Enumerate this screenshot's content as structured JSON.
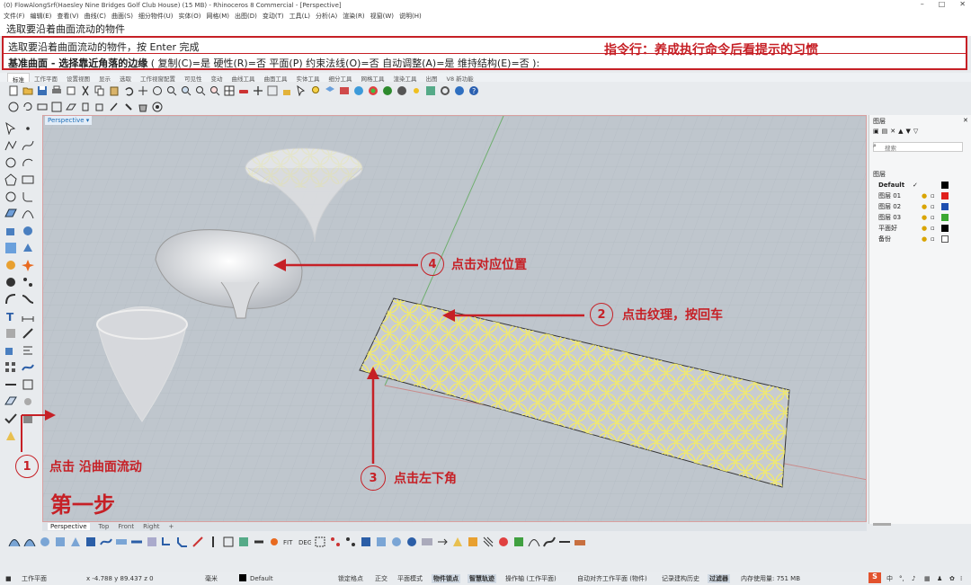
{
  "window": {
    "title": "(0) FlowAlongSrf(Haesley Nine Bridges Golf Club House) (15 MB) - Rhinoceros 8 Commercial - [Perspective]",
    "controls": [
      "–",
      "□",
      "✕"
    ]
  },
  "menubar": [
    "文件(F)",
    "编辑(E)",
    "查看(V)",
    "曲线(C)",
    "曲面(S)",
    "细分物件(U)",
    "实体(O)",
    "网格(M)",
    "出图(D)",
    "变动(T)",
    "工具(L)",
    "分析(A)",
    "渲染(R)",
    "视窗(W)",
    "说明(H)"
  ],
  "command": {
    "history": "选取要沿着曲面流动的物件",
    "prompt1": "选取要沿着曲面流动的物件，按 Enter 完成",
    "prompt2_bold": "基准曲面 - 选择靠近角落的边缘",
    "prompt2_rest": " ( 复制(C)=是  硬性(R)=否  平面(P)  约束法线(O)=否  自动调整(A)=是  维持结构(E)=否 ):",
    "note": "指令行：养成执行命令后看提示的习惯"
  },
  "tabs": [
    "标准",
    "工作平面",
    "设置视图",
    "显示",
    "选取",
    "工作视窗配置",
    "可见性",
    "变动",
    "曲线工具",
    "曲面工具",
    "实体工具",
    "细分工具",
    "网格工具",
    "渲染工具",
    "出图",
    "V8 新功能"
  ],
  "viewport": {
    "label": "Perspective",
    "bottom_tabs": [
      "Perspective",
      "Top",
      "Front",
      "Right",
      "+"
    ]
  },
  "annotations": {
    "step1": {
      "num": "1",
      "text": "点击  沿曲面流动"
    },
    "step2": {
      "num": "2",
      "text": "点击纹理，按回车"
    },
    "step3": {
      "num": "3",
      "text": "点击左下角"
    },
    "step4": {
      "num": "4",
      "text": "点击对应位置"
    },
    "first_step": "第一步"
  },
  "panel": {
    "title": "图层",
    "search": "搜索",
    "header": "图层",
    "layers": [
      {
        "name": "Default",
        "color": "#000000",
        "current": true
      },
      {
        "name": "图层 01",
        "color": "#e0201c",
        "current": false
      },
      {
        "name": "图层 02",
        "color": "#1e4fb0",
        "current": false
      },
      {
        "name": "图层 03",
        "color": "#3ca832",
        "current": false
      },
      {
        "name": "平面好",
        "color": "#000000",
        "current": false
      },
      {
        "name": "备份",
        "color": "#ffffff",
        "current": false
      }
    ]
  },
  "status": {
    "cplane": "工作平面",
    "coords": "x -4.788  y 89.437  z 0",
    "units": "毫米",
    "layer": "Default",
    "toggles": [
      "锁定格点",
      "正交",
      "平面模式",
      "物件锁点",
      "智慧轨迹",
      "操作轴 (工作平面)",
      "自动对齐工作平面 (物件)",
      "记录建构历史",
      "过滤器"
    ],
    "memory": "内存使用量: 751 MB"
  },
  "colors": {
    "accent": "#c62026",
    "pattern": "#f2ea6a"
  }
}
